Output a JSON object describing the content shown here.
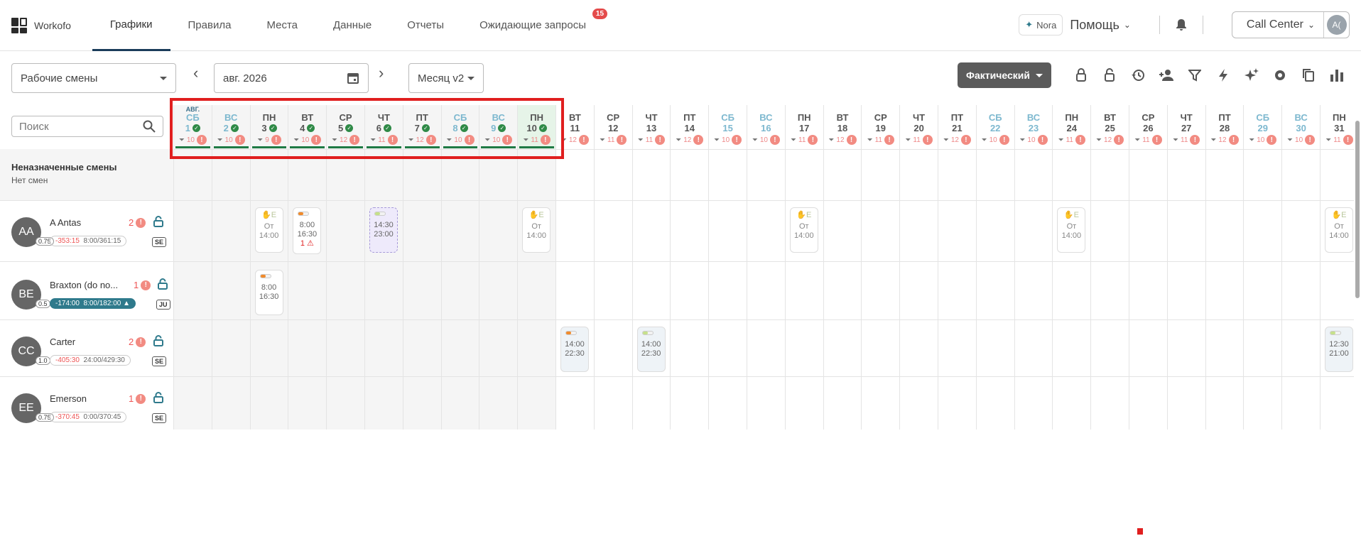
{
  "app": {
    "name": "Workofo"
  },
  "nav": [
    {
      "label": "Графики",
      "active": true
    },
    {
      "label": "Правила"
    },
    {
      "label": "Места"
    },
    {
      "label": "Данные"
    },
    {
      "label": "Отчеты"
    },
    {
      "label": "Ожидающие запросы",
      "badge": "15"
    }
  ],
  "topright": {
    "nora": "Nora",
    "help": "Помощь",
    "org": "Call Center",
    "avatar": "A("
  },
  "toolbar": {
    "view_select": "Рабочие смены",
    "date": "авг. 2026",
    "mode_select": "Месяц v2",
    "actual_button": "Фактический"
  },
  "search": {
    "placeholder": "Поиск"
  },
  "unassigned": {
    "title": "Неназначенные смены",
    "subtitle": "Нет смен"
  },
  "month_label": "АВГ.",
  "days": [
    {
      "dow": "СБ",
      "d": "1",
      "ok": true,
      "cnt": "10",
      "we": true
    },
    {
      "dow": "ВС",
      "d": "2",
      "ok": true,
      "cnt": "10",
      "we": true
    },
    {
      "dow": "ПН",
      "d": "3",
      "ok": true,
      "cnt": "9"
    },
    {
      "dow": "ВТ",
      "d": "4",
      "ok": true,
      "cnt": "10"
    },
    {
      "dow": "СР",
      "d": "5",
      "ok": true,
      "cnt": "12"
    },
    {
      "dow": "ЧТ",
      "d": "6",
      "ok": true,
      "cnt": "11"
    },
    {
      "dow": "ПТ",
      "d": "7",
      "ok": true,
      "cnt": "12"
    },
    {
      "dow": "СБ",
      "d": "8",
      "ok": true,
      "cnt": "10",
      "we": true
    },
    {
      "dow": "ВС",
      "d": "9",
      "ok": true,
      "cnt": "10",
      "we": true
    },
    {
      "dow": "ПН",
      "d": "10",
      "ok": true,
      "cnt": "11",
      "today": true
    },
    {
      "dow": "ВТ",
      "d": "11",
      "cnt": "12"
    },
    {
      "dow": "СР",
      "d": "12",
      "cnt": "11"
    },
    {
      "dow": "ЧТ",
      "d": "13",
      "cnt": "11"
    },
    {
      "dow": "ПТ",
      "d": "14",
      "cnt": "12"
    },
    {
      "dow": "СБ",
      "d": "15",
      "cnt": "10",
      "we": true
    },
    {
      "dow": "ВС",
      "d": "16",
      "cnt": "10",
      "we": true
    },
    {
      "dow": "ПН",
      "d": "17",
      "cnt": "11"
    },
    {
      "dow": "ВТ",
      "d": "18",
      "cnt": "12"
    },
    {
      "dow": "СР",
      "d": "19",
      "cnt": "11"
    },
    {
      "dow": "ЧТ",
      "d": "20",
      "cnt": "11"
    },
    {
      "dow": "ПТ",
      "d": "21",
      "cnt": "12"
    },
    {
      "dow": "СБ",
      "d": "22",
      "cnt": "10",
      "we": true
    },
    {
      "dow": "ВС",
      "d": "23",
      "cnt": "10",
      "we": true
    },
    {
      "dow": "ПН",
      "d": "24",
      "cnt": "11"
    },
    {
      "dow": "ВТ",
      "d": "25",
      "cnt": "12"
    },
    {
      "dow": "СР",
      "d": "26",
      "cnt": "11"
    },
    {
      "dow": "ЧТ",
      "d": "27",
      "cnt": "11"
    },
    {
      "dow": "ПТ",
      "d": "28",
      "cnt": "12"
    },
    {
      "dow": "СБ",
      "d": "29",
      "cnt": "10",
      "we": true
    },
    {
      "dow": "ВС",
      "d": "30",
      "cnt": "10",
      "we": true
    },
    {
      "dow": "ПН",
      "d": "31",
      "cnt": "11"
    }
  ],
  "employees": [
    {
      "initials": "AA",
      "fte": "0.75",
      "name": "A Antas",
      "count": "2",
      "neg": "-353:15",
      "hours": "8:00/361:15",
      "code": "SE"
    },
    {
      "initials": "BE",
      "fte": "0.5",
      "name": "Braxton (do no...",
      "count": "1",
      "neg": "-174:00",
      "hours": "8:00/182:00",
      "code": "JU",
      "blue": true
    },
    {
      "initials": "CC",
      "fte": "1.0",
      "name": "Carter",
      "count": "2",
      "neg": "-405:30",
      "hours": "24:00/429:30",
      "code": "SE"
    },
    {
      "initials": "EE",
      "fte": "0.75",
      "name": "Emerson",
      "count": "1",
      "neg": "-370:45",
      "hours": "0:00/370:45",
      "code": "SE"
    }
  ],
  "shifts": [
    {
      "row": 0,
      "day": 3,
      "kind": "ghost",
      "hand": "E",
      "l1": "От",
      "l2": "14:00"
    },
    {
      "row": 0,
      "day": 4,
      "kind": "normal",
      "bar": "#f08a2b",
      "l1": "8:00",
      "l2": "16:30",
      "warn": "1"
    },
    {
      "row": 0,
      "day": 6,
      "kind": "dashed",
      "bar": "#c5e08a",
      "l1": "14:30",
      "l2": "23:00"
    },
    {
      "row": 0,
      "day": 10,
      "kind": "ghost",
      "hand": "E",
      "l1": "От",
      "l2": "14:00"
    },
    {
      "row": 0,
      "day": 17,
      "kind": "ghost",
      "hand": "E",
      "l1": "От",
      "l2": "14:00"
    },
    {
      "row": 0,
      "day": 24,
      "kind": "ghost",
      "hand": "E",
      "l1": "От",
      "l2": "14:00"
    },
    {
      "row": 0,
      "day": 31,
      "kind": "ghost",
      "hand": "E",
      "l1": "От",
      "l2": "14:00"
    },
    {
      "row": 1,
      "day": 3,
      "kind": "normal",
      "bar": "#f08a2b",
      "l1": "8:00",
      "l2": "16:30"
    },
    {
      "row": 2,
      "day": 11,
      "kind": "light",
      "bar": "#f08a2b",
      "l1": "14:00",
      "l2": "22:30"
    },
    {
      "row": 2,
      "day": 13,
      "kind": "light",
      "bar": "#c5e08a",
      "l1": "14:00",
      "l2": "22:30"
    },
    {
      "row": 2,
      "day": 31,
      "kind": "light",
      "bar": "#c5e08a",
      "l1": "12:30",
      "l2": "21:00"
    }
  ],
  "colors": {
    "accent": "#1a3c5a",
    "ok": "#2f8a47",
    "err": "#f28b82",
    "highlight": "#e01f1f"
  }
}
